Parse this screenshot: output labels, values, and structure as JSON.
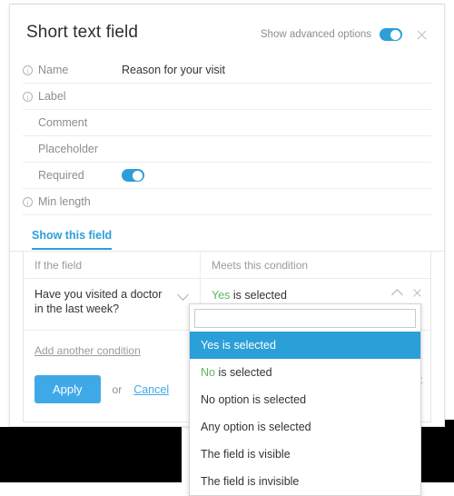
{
  "header": {
    "title": "Short text field",
    "advanced_label": "Show advanced options",
    "advanced_toggle_on": true,
    "close_icon": "close-icon"
  },
  "properties": [
    {
      "label": "Name",
      "value": "Reason for your visit",
      "has_info": true,
      "type": "text"
    },
    {
      "label": "Label",
      "value": "",
      "has_info": true,
      "type": "text"
    },
    {
      "label": "Comment",
      "value": "",
      "has_info": false,
      "type": "text"
    },
    {
      "label": "Placeholder",
      "value": "",
      "has_info": false,
      "type": "text"
    },
    {
      "label": "Required",
      "value": "",
      "has_info": false,
      "type": "toggle",
      "toggle_on": true
    },
    {
      "label": "Min length",
      "value": "",
      "has_info": true,
      "type": "text"
    }
  ],
  "conditions": {
    "tab_label": "Show this field",
    "columns": {
      "left": "If the field",
      "right": "Meets this condition"
    },
    "row": {
      "field_text": "Have you visited a doctor in the last week?",
      "condition_prefix": "Yes",
      "condition_rest": " is selected"
    },
    "add_another": "Add another condition",
    "apply_label": "Apply",
    "or_label": "or",
    "cancel_label": "Cancel",
    "delete_label": "Delete"
  },
  "dropdown": {
    "search_value": "",
    "options": [
      {
        "text": "Yes is selected",
        "prefix": "Yes",
        "rest": " is selected",
        "selected": true
      },
      {
        "text": "No is selected",
        "prefix": "No",
        "rest": " is selected",
        "selected": false
      },
      {
        "text": "No option is selected",
        "prefix": "",
        "rest": "No option is selected",
        "selected": false
      },
      {
        "text": "Any option is selected",
        "prefix": "",
        "rest": "Any option is selected",
        "selected": false
      },
      {
        "text": "The field is visible",
        "prefix": "",
        "rest": "The field is visible",
        "selected": false
      },
      {
        "text": "The field is invisible",
        "prefix": "",
        "rest": "The field is invisible",
        "selected": false
      }
    ]
  },
  "colors": {
    "accent_blue": "#2c9fd9",
    "button_blue": "#3fa9e8",
    "highlight_blue": "#2a9fd8",
    "option_green": "#5cb85c",
    "label_gray": "#8d8d8d"
  }
}
